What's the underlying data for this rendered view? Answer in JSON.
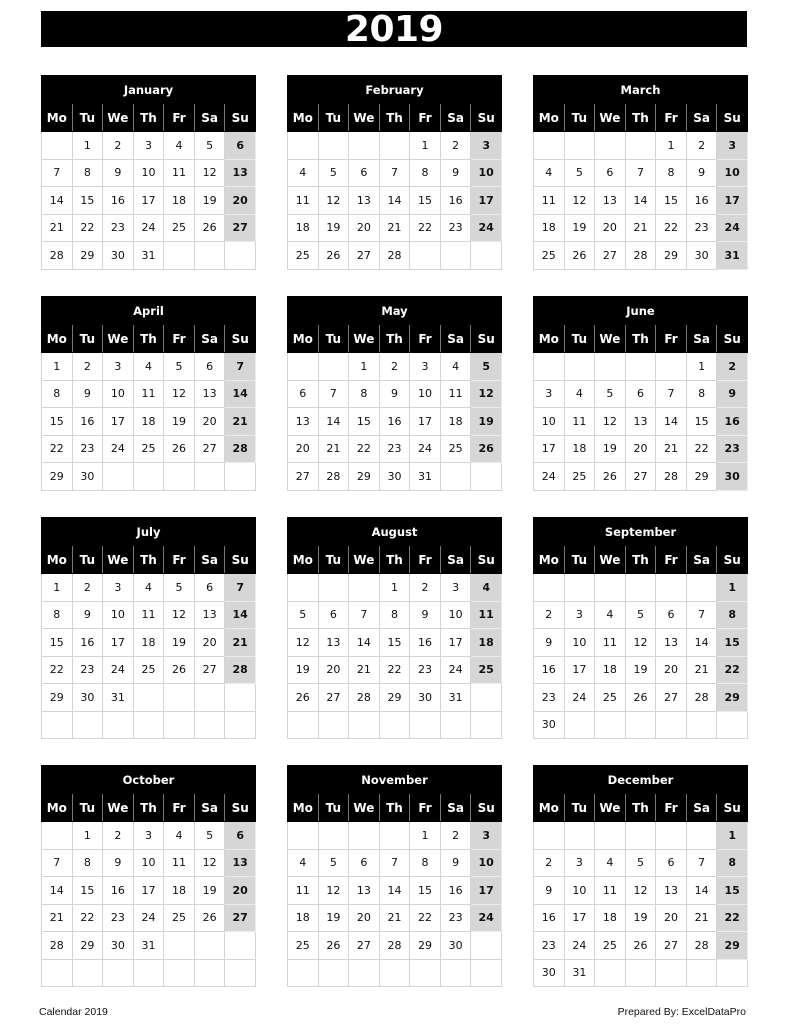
{
  "title": "2019",
  "weekdays": [
    "Mo",
    "Tu",
    "We",
    "Th",
    "Fr",
    "Sa",
    "Su"
  ],
  "colors": {
    "header_bg": "#000000",
    "header_text": "#ffffff",
    "sunday_bg": "#d6d6d6",
    "grid_line": "#d4d4d4"
  },
  "months": [
    {
      "name": "January",
      "weeks": [
        [
          "",
          "1",
          "2",
          "3",
          "4",
          "5",
          "6"
        ],
        [
          "7",
          "8",
          "9",
          "10",
          "11",
          "12",
          "13"
        ],
        [
          "14",
          "15",
          "16",
          "17",
          "18",
          "19",
          "20"
        ],
        [
          "21",
          "22",
          "23",
          "24",
          "25",
          "26",
          "27"
        ],
        [
          "28",
          "29",
          "30",
          "31",
          "",
          "",
          ""
        ]
      ]
    },
    {
      "name": "February",
      "weeks": [
        [
          "",
          "",
          "",
          "",
          "1",
          "2",
          "3"
        ],
        [
          "4",
          "5",
          "6",
          "7",
          "8",
          "9",
          "10"
        ],
        [
          "11",
          "12",
          "13",
          "14",
          "15",
          "16",
          "17"
        ],
        [
          "18",
          "19",
          "20",
          "21",
          "22",
          "23",
          "24"
        ],
        [
          "25",
          "26",
          "27",
          "28",
          "",
          "",
          ""
        ]
      ]
    },
    {
      "name": "March",
      "weeks": [
        [
          "",
          "",
          "",
          "",
          "1",
          "2",
          "3"
        ],
        [
          "4",
          "5",
          "6",
          "7",
          "8",
          "9",
          "10"
        ],
        [
          "11",
          "12",
          "13",
          "14",
          "15",
          "16",
          "17"
        ],
        [
          "18",
          "19",
          "20",
          "21",
          "22",
          "23",
          "24"
        ],
        [
          "25",
          "26",
          "27",
          "28",
          "29",
          "30",
          "31"
        ]
      ]
    },
    {
      "name": "April",
      "weeks": [
        [
          "1",
          "2",
          "3",
          "4",
          "5",
          "6",
          "7"
        ],
        [
          "8",
          "9",
          "10",
          "11",
          "12",
          "13",
          "14"
        ],
        [
          "15",
          "16",
          "17",
          "18",
          "19",
          "20",
          "21"
        ],
        [
          "22",
          "23",
          "24",
          "25",
          "26",
          "27",
          "28"
        ],
        [
          "29",
          "30",
          "",
          "",
          "",
          "",
          ""
        ]
      ]
    },
    {
      "name": "May",
      "weeks": [
        [
          "",
          "",
          "1",
          "2",
          "3",
          "4",
          "5"
        ],
        [
          "6",
          "7",
          "8",
          "9",
          "10",
          "11",
          "12"
        ],
        [
          "13",
          "14",
          "15",
          "16",
          "17",
          "18",
          "19"
        ],
        [
          "20",
          "21",
          "22",
          "23",
          "24",
          "25",
          "26"
        ],
        [
          "27",
          "28",
          "29",
          "30",
          "31",
          "",
          ""
        ]
      ]
    },
    {
      "name": "June",
      "weeks": [
        [
          "",
          "",
          "",
          "",
          "",
          "1",
          "2"
        ],
        [
          "3",
          "4",
          "5",
          "6",
          "7",
          "8",
          "9"
        ],
        [
          "10",
          "11",
          "12",
          "13",
          "14",
          "15",
          "16"
        ],
        [
          "17",
          "18",
          "19",
          "20",
          "21",
          "22",
          "23"
        ],
        [
          "24",
          "25",
          "26",
          "27",
          "28",
          "29",
          "30"
        ]
      ]
    },
    {
      "name": "July",
      "weeks": [
        [
          "1",
          "2",
          "3",
          "4",
          "5",
          "6",
          "7"
        ],
        [
          "8",
          "9",
          "10",
          "11",
          "12",
          "13",
          "14"
        ],
        [
          "15",
          "16",
          "17",
          "18",
          "19",
          "20",
          "21"
        ],
        [
          "22",
          "23",
          "24",
          "25",
          "26",
          "27",
          "28"
        ],
        [
          "29",
          "30",
          "31",
          "",
          "",
          "",
          ""
        ],
        [
          "",
          "",
          "",
          "",
          "",
          "",
          ""
        ]
      ]
    },
    {
      "name": "August",
      "weeks": [
        [
          "",
          "",
          "",
          "1",
          "2",
          "3",
          "4"
        ],
        [
          "5",
          "6",
          "7",
          "8",
          "9",
          "10",
          "11"
        ],
        [
          "12",
          "13",
          "14",
          "15",
          "16",
          "17",
          "18"
        ],
        [
          "19",
          "20",
          "21",
          "22",
          "23",
          "24",
          "25"
        ],
        [
          "26",
          "27",
          "28",
          "29",
          "30",
          "31",
          ""
        ],
        [
          "",
          "",
          "",
          "",
          "",
          "",
          ""
        ]
      ]
    },
    {
      "name": "September",
      "weeks": [
        [
          "",
          "",
          "",
          "",
          "",
          "",
          "1"
        ],
        [
          "2",
          "3",
          "4",
          "5",
          "6",
          "7",
          "8"
        ],
        [
          "9",
          "10",
          "11",
          "12",
          "13",
          "14",
          "15"
        ],
        [
          "16",
          "17",
          "18",
          "19",
          "20",
          "21",
          "22"
        ],
        [
          "23",
          "24",
          "25",
          "26",
          "27",
          "28",
          "29"
        ],
        [
          "30",
          "",
          "",
          "",
          "",
          "",
          ""
        ]
      ]
    },
    {
      "name": "October",
      "weeks": [
        [
          "",
          "1",
          "2",
          "3",
          "4",
          "5",
          "6"
        ],
        [
          "7",
          "8",
          "9",
          "10",
          "11",
          "12",
          "13"
        ],
        [
          "14",
          "15",
          "16",
          "17",
          "18",
          "19",
          "20"
        ],
        [
          "21",
          "22",
          "23",
          "24",
          "25",
          "26",
          "27"
        ],
        [
          "28",
          "29",
          "30",
          "31",
          "",
          "",
          ""
        ],
        [
          "",
          "",
          "",
          "",
          "",
          "",
          ""
        ]
      ]
    },
    {
      "name": "November",
      "weeks": [
        [
          "",
          "",
          "",
          "",
          "1",
          "2",
          "3"
        ],
        [
          "4",
          "5",
          "6",
          "7",
          "8",
          "9",
          "10"
        ],
        [
          "11",
          "12",
          "13",
          "14",
          "15",
          "16",
          "17"
        ],
        [
          "18",
          "19",
          "20",
          "21",
          "22",
          "23",
          "24"
        ],
        [
          "25",
          "26",
          "27",
          "28",
          "29",
          "30",
          ""
        ],
        [
          "",
          "",
          "",
          "",
          "",
          "",
          ""
        ]
      ]
    },
    {
      "name": "December",
      "weeks": [
        [
          "",
          "",
          "",
          "",
          "",
          "",
          "1"
        ],
        [
          "2",
          "3",
          "4",
          "5",
          "6",
          "7",
          "8"
        ],
        [
          "9",
          "10",
          "11",
          "12",
          "13",
          "14",
          "15"
        ],
        [
          "16",
          "17",
          "18",
          "19",
          "20",
          "21",
          "22"
        ],
        [
          "23",
          "24",
          "25",
          "26",
          "27",
          "28",
          "29"
        ],
        [
          "30",
          "31",
          "",
          "",
          "",
          "",
          ""
        ]
      ]
    }
  ],
  "footer": {
    "left": "Calendar 2019",
    "right": "Prepared By: ExcelDataPro"
  }
}
